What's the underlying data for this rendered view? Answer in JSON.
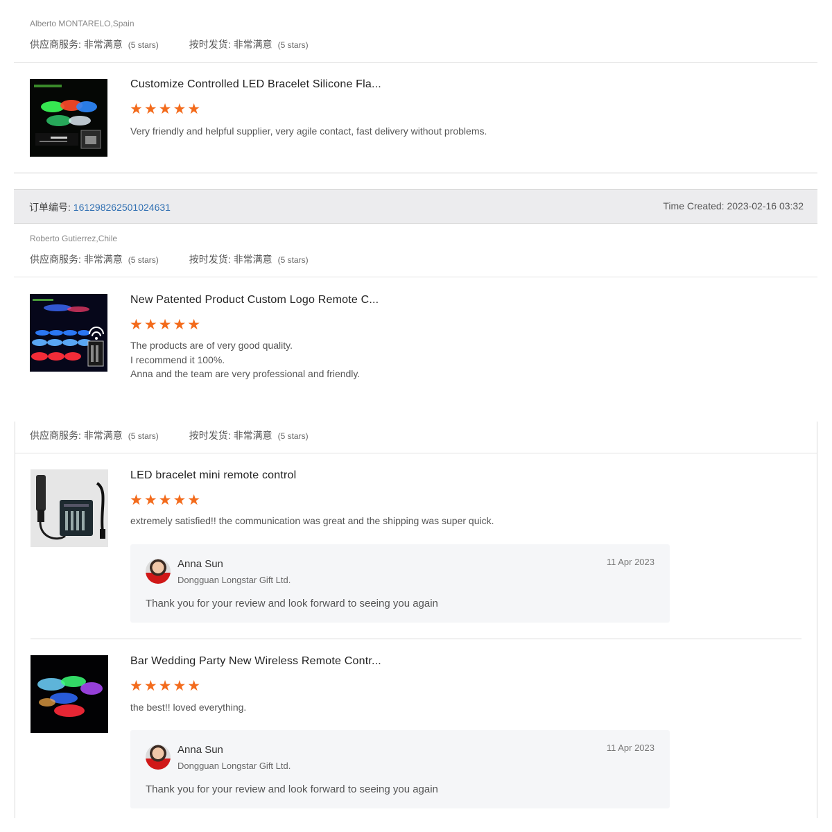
{
  "rating_labels": {
    "service": "供应商服务:",
    "delivery": "按时发货:",
    "value": "非常满意",
    "count": "(5 stars)"
  },
  "reviews": [
    {
      "reviewer": "Alberto MONTARELO,Spain",
      "product_title": "Customize Controlled LED Bracelet Silicone Fla...",
      "stars": "★★★★★",
      "comment": "Very friendly and helpful supplier, very agile contact, fast delivery without problems."
    },
    {
      "reviewer": "Roberto Gutierrez,Chile",
      "product_title": "New Patented Product Custom Logo Remote C...",
      "stars": "★★★★★",
      "comment": "The products are of very good quality.\nI recommend it 100%.\nAnna and the team are very professional and friendly."
    },
    {
      "product_title": "LED bracelet mini remote control",
      "stars": "★★★★★",
      "comment": "extremely satisfied!! the communication was great and the shipping was super quick.",
      "reply": {
        "name": "Anna Sun",
        "company": "Dongguan Longstar Gift Ltd.",
        "date": "11 Apr 2023",
        "message": "Thank you for your review and look forward to seeing you again"
      }
    },
    {
      "product_title": "Bar Wedding Party New Wireless Remote Contr...",
      "stars": "★★★★★",
      "comment": "the best!! loved everything.",
      "reply": {
        "name": "Anna Sun",
        "company": "Dongguan Longstar Gift Ltd.",
        "date": "11 Apr 2023",
        "message": "Thank you for your review and look forward to seeing you again"
      }
    }
  ],
  "order": {
    "label": "订单编号:",
    "number": "161298262501024631",
    "time_created": "Time Created: 2023-02-16 03:32"
  },
  "colors": {
    "star": "#f36b1c",
    "order_link": "#2f6fb2",
    "order_bar_bg": "#ececee",
    "reply_bg": "#f5f6f8"
  }
}
